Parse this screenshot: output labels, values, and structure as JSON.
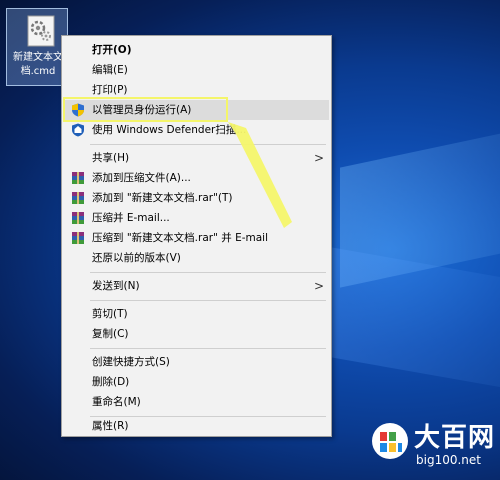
{
  "desktop": {
    "icon_label": "新建文本文档.cmd"
  },
  "menu": {
    "items": [
      {
        "label": "打开(O)"
      },
      {
        "label": "编辑(E)"
      },
      {
        "label": "打印(P)"
      },
      {
        "label": "以管理员身份运行(A)"
      },
      {
        "label": "使用 Windows Defender扫描..."
      },
      {
        "label": "共享(H)"
      },
      {
        "label": "添加到压缩文件(A)..."
      },
      {
        "label": "添加到 \"新建文本文档.rar\"(T)"
      },
      {
        "label": "压缩并 E-mail..."
      },
      {
        "label": "压缩到 \"新建文本文档.rar\" 并 E-mail"
      },
      {
        "label": "还原以前的版本(V)"
      },
      {
        "label": "发送到(N)"
      },
      {
        "label": "剪切(T)"
      },
      {
        "label": "复制(C)"
      },
      {
        "label": "创建快捷方式(S)"
      },
      {
        "label": "删除(D)"
      },
      {
        "label": "重命名(M)"
      },
      {
        "label": "属性(R)"
      }
    ],
    "highlight_color": "#f4f56a"
  },
  "watermark": {
    "title": "大百网",
    "subtitle": "big100.net"
  }
}
